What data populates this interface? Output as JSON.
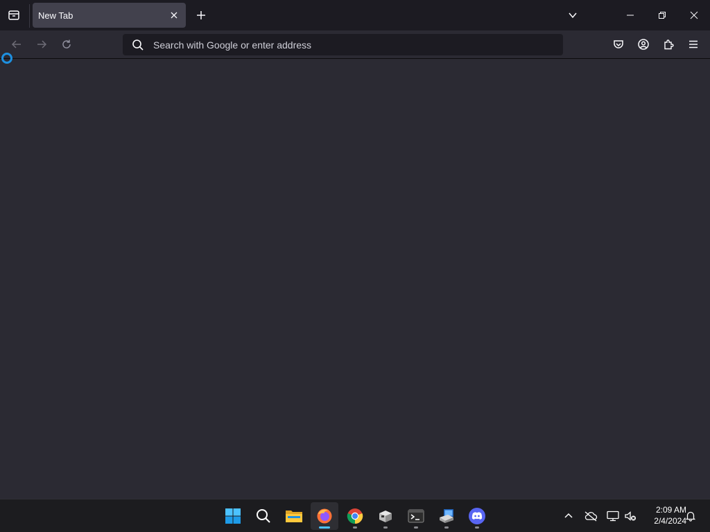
{
  "browser": {
    "tab": {
      "title": "New Tab"
    },
    "urlbar": {
      "placeholder": "Search with Google or enter address",
      "value": ""
    }
  },
  "taskbar": {
    "apps": [
      "start",
      "search",
      "file-explorer",
      "firefox",
      "chrome",
      "app-cube",
      "terminal",
      "app-installer",
      "discord"
    ],
    "clock": {
      "time": "2:09 AM",
      "date": "2/4/2024"
    }
  },
  "colors": {
    "chrome_bg": "#1c1b22",
    "content_bg": "#2b2a33",
    "tab_active": "#42414d",
    "accent": "#4cc2ff"
  }
}
